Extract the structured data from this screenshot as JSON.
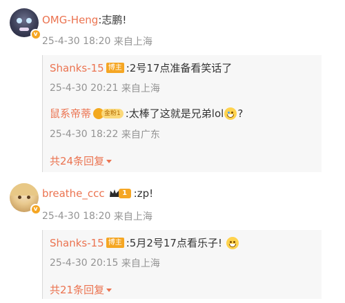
{
  "comments": [
    {
      "user": "OMG-Heng",
      "sep": ":",
      "text": "志鹏!",
      "time": "25-4-30 18:20",
      "location": "来自上海",
      "replies": [
        {
          "user": "Shanks-15",
          "badge": "博主",
          "text": ":2号17点准备看笑话了",
          "time": "25-4-30 20:21",
          "location": "来自上海"
        },
        {
          "user": "鼠系帝蒂",
          "badge": "金粉1",
          "text": ":太棒了这就是兄弟lol",
          "text_after": "?",
          "time": "25-4-30 18:22",
          "location": "来自广东"
        }
      ],
      "more": "共24条回复"
    },
    {
      "user": "breathe_ccc",
      "level": "1",
      "sep": ":",
      "text": "zp!",
      "time": "25-4-30 18:20",
      "location": "来自上海",
      "replies": [
        {
          "user": "Shanks-15",
          "badge": "博主",
          "text": ":5月2号17点看乐子!",
          "time": "25-4-30 20:15",
          "location": "来自上海"
        }
      ],
      "more": "共21条回复"
    }
  ],
  "colors": {
    "username": "#eb7350",
    "text": "#333333",
    "meta": "#939393",
    "badge": "#f5a623"
  },
  "icons": [
    "verified-icon",
    "blogger-badge",
    "gold-fan-badge",
    "crown-level-badge",
    "grin-emoji",
    "cry-laugh-emoji",
    "caret-down-icon"
  ]
}
